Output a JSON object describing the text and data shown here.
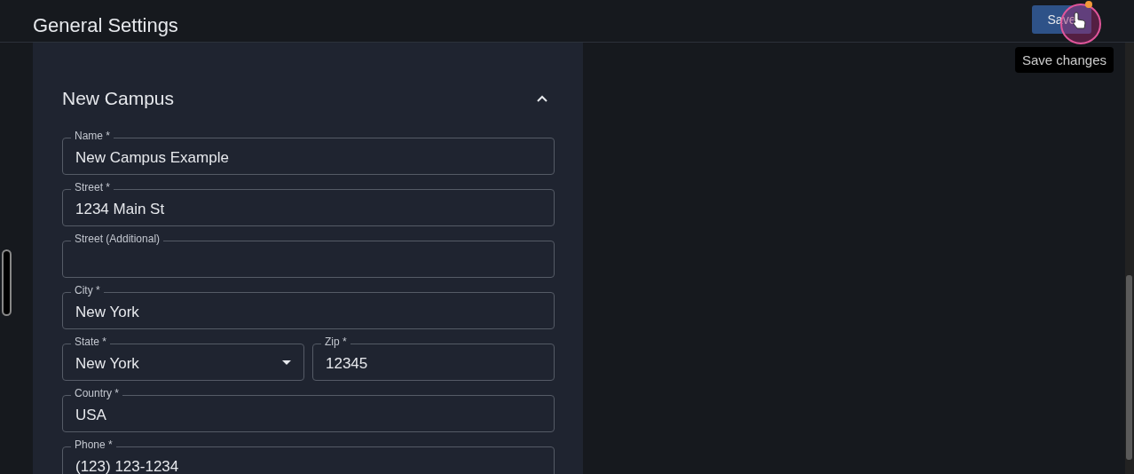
{
  "header": {
    "title": "General Settings",
    "save_button": "Save",
    "tooltip": "Save changes"
  },
  "section": {
    "title": "New Campus",
    "expanded": true,
    "rows": [
      [
        {
          "label": "Name *",
          "value": "New Campus Example",
          "kind": "text"
        }
      ],
      [
        {
          "label": "Street *",
          "value": "1234 Main St",
          "kind": "text"
        }
      ],
      [
        {
          "label": "Street (Additional)",
          "kind": "text"
        }
      ],
      [
        {
          "label": "City *",
          "value": "New York",
          "kind": "text"
        }
      ],
      [
        {
          "label": "State *",
          "value": "New York",
          "kind": "select"
        },
        {
          "label": "Zip *",
          "value": "12345",
          "kind": "text"
        }
      ],
      [
        {
          "label": "Country *",
          "value": "USA",
          "kind": "text"
        }
      ],
      [
        {
          "label": "Phone *",
          "value": "(123) 123-1234",
          "kind": "text"
        }
      ]
    ]
  }
}
